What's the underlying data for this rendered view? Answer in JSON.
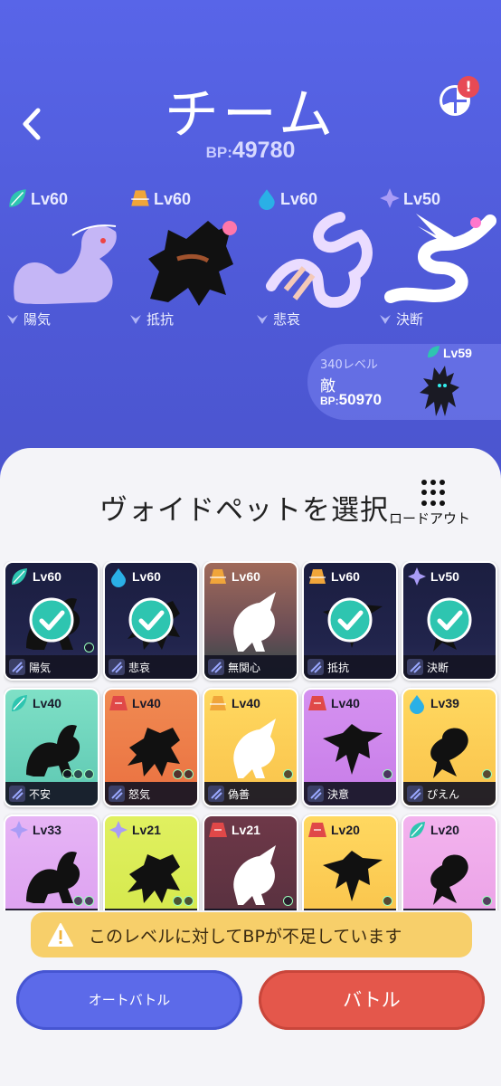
{
  "header": {
    "title": "チーム",
    "bp_label": "BP:",
    "bp_value": "49780",
    "notification_badge": "!",
    "back_icon": "chevron-left-icon"
  },
  "team": [
    {
      "lv": "Lv60",
      "element": "leaf",
      "emotion": "陽気",
      "color": "#c6b8f7"
    },
    {
      "lv": "Lv60",
      "element": "earth",
      "emotion": "抵抗",
      "color": "#111111"
    },
    {
      "lv": "Lv60",
      "element": "water",
      "emotion": "悲哀",
      "color": "#e6d6f7"
    },
    {
      "lv": "Lv50",
      "element": "crystal",
      "emotion": "決断",
      "color": "#ffffff"
    }
  ],
  "enemy": {
    "level_text": "340レベル",
    "label": "敵",
    "bp_label": "BP:",
    "bp_value": "50970",
    "lv": "Lv59"
  },
  "sheet": {
    "title": "ヴォイドペットを選択",
    "loadout_label": "ロードアウト"
  },
  "pets": [
    {
      "lv": "Lv60",
      "element": "leaf",
      "emotion": "陽気",
      "selected": true,
      "bg": "dark",
      "stars": 1
    },
    {
      "lv": "Lv60",
      "element": "water",
      "emotion": "悲哀",
      "selected": true,
      "bg": "dark",
      "stars": 0
    },
    {
      "lv": "Lv60",
      "element": "earth",
      "emotion": "無関心",
      "selected": false,
      "bg": "rust",
      "stars": 0
    },
    {
      "lv": "Lv60",
      "element": "earth",
      "emotion": "抵抗",
      "selected": true,
      "bg": "dark",
      "stars": 0
    },
    {
      "lv": "Lv50",
      "element": "crystal",
      "emotion": "決断",
      "selected": true,
      "bg": "dark",
      "stars": 0
    },
    {
      "lv": "Lv40",
      "element": "leaf",
      "emotion": "不安",
      "selected": false,
      "bg": "mint",
      "stars": 3
    },
    {
      "lv": "Lv40",
      "element": "fire",
      "emotion": "怒気",
      "selected": false,
      "bg": "orange",
      "stars": 2
    },
    {
      "lv": "Lv40",
      "element": "earth",
      "emotion": "偽善",
      "selected": false,
      "bg": "yellow",
      "stars": 1
    },
    {
      "lv": "Lv40",
      "element": "fire",
      "emotion": "決意",
      "selected": false,
      "bg": "violet",
      "stars": 1
    },
    {
      "lv": "Lv39",
      "element": "water",
      "emotion": "ぴえん",
      "selected": false,
      "bg": "yellow",
      "stars": 1
    },
    {
      "lv": "Lv33",
      "element": "crystal",
      "emotion": "",
      "selected": false,
      "bg": "lilac",
      "stars": 2
    },
    {
      "lv": "Lv21",
      "element": "crystal",
      "emotion": "",
      "selected": false,
      "bg": "lime",
      "stars": 2
    },
    {
      "lv": "Lv21",
      "element": "fire",
      "emotion": "",
      "selected": false,
      "bg": "maroon",
      "stars": 1
    },
    {
      "lv": "Lv20",
      "element": "fire",
      "emotion": "",
      "selected": false,
      "bg": "yellow",
      "stars": 1
    },
    {
      "lv": "Lv20",
      "element": "leaf",
      "emotion": "",
      "selected": false,
      "bg": "pink",
      "stars": 1
    }
  ],
  "warning": {
    "text": "このレベルに対してBPが不足しています",
    "icon": "warning-triangle-icon"
  },
  "buttons": {
    "auto": "オートバトル",
    "battle": "バトル"
  },
  "colors": {
    "header_bg": "#5865e8",
    "battle": "#e4574b",
    "auto": "#5c6ae9",
    "warning": "#f7cf6a",
    "check": "#2ec5b0"
  }
}
